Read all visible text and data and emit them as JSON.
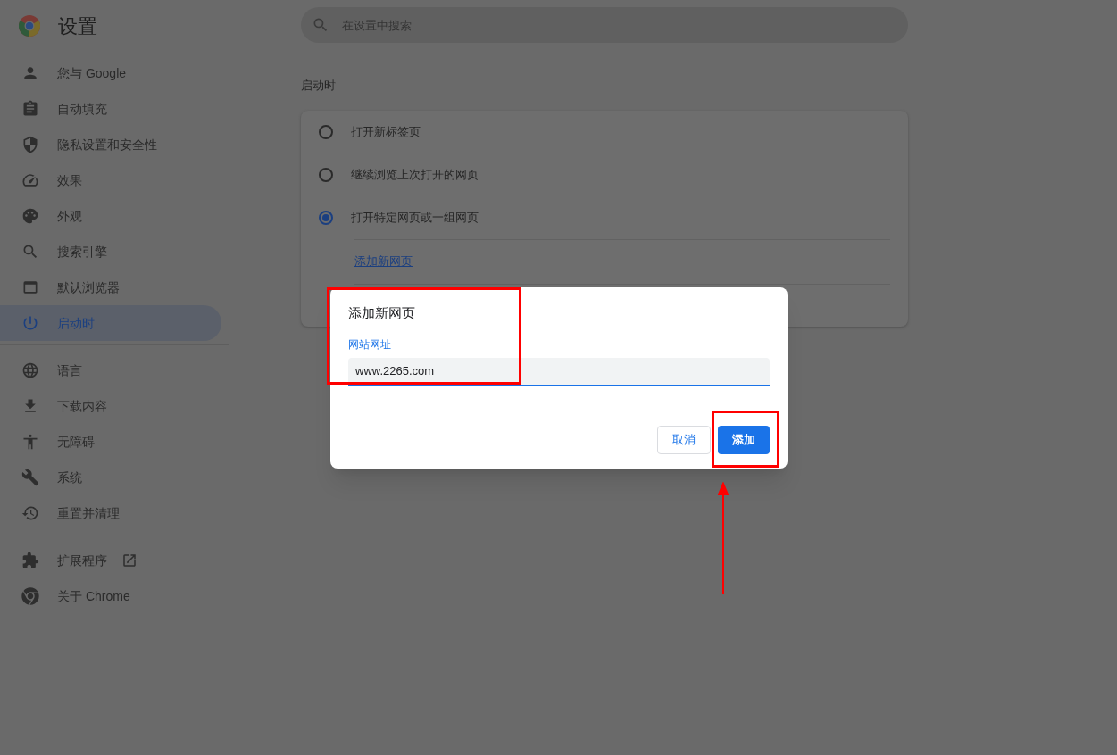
{
  "header": {
    "title": "设置"
  },
  "search": {
    "placeholder": "在设置中搜索"
  },
  "sidebar": {
    "sections": [
      {
        "items": [
          {
            "label": "您与 Google",
            "selected": false,
            "kind": "page"
          },
          {
            "label": "自动填充",
            "selected": false,
            "kind": "page"
          },
          {
            "label": "隐私设置和安全性",
            "selected": false,
            "kind": "page"
          },
          {
            "label": "效果",
            "selected": false,
            "kind": "page"
          },
          {
            "label": "外观",
            "selected": false,
            "kind": "page"
          },
          {
            "label": "搜索引擎",
            "selected": false,
            "kind": "page"
          },
          {
            "label": "默认浏览器",
            "selected": false,
            "kind": "page"
          },
          {
            "label": "启动时",
            "selected": true,
            "kind": "page"
          }
        ]
      },
      {
        "items": [
          {
            "label": "语言",
            "selected": false,
            "kind": "page"
          },
          {
            "label": "下载内容",
            "selected": false,
            "kind": "page"
          },
          {
            "label": "无障碍",
            "selected": false,
            "kind": "page"
          },
          {
            "label": "系统",
            "selected": false,
            "kind": "page"
          },
          {
            "label": "重置并清理",
            "selected": false,
            "kind": "page"
          }
        ]
      },
      {
        "items": [
          {
            "label": "扩展程序",
            "selected": false,
            "kind": "external"
          },
          {
            "label": "关于 Chrome",
            "selected": false,
            "kind": "page"
          }
        ]
      }
    ]
  },
  "startup": {
    "title": "启动时",
    "options": [
      {
        "label": "打开新标签页",
        "selected": false
      },
      {
        "label": "继续浏览上次打开的网页",
        "selected": false
      },
      {
        "label": "打开特定网页或一组网页",
        "selected": true
      }
    ],
    "add_link": "添加新网页"
  },
  "dialog": {
    "title": "添加新网页",
    "field_label": "网站网址",
    "value": "www.2265.com",
    "buttons": [
      {
        "label": "取消",
        "kind": "secondary"
      },
      {
        "label": "添加",
        "kind": "primary"
      }
    ]
  }
}
